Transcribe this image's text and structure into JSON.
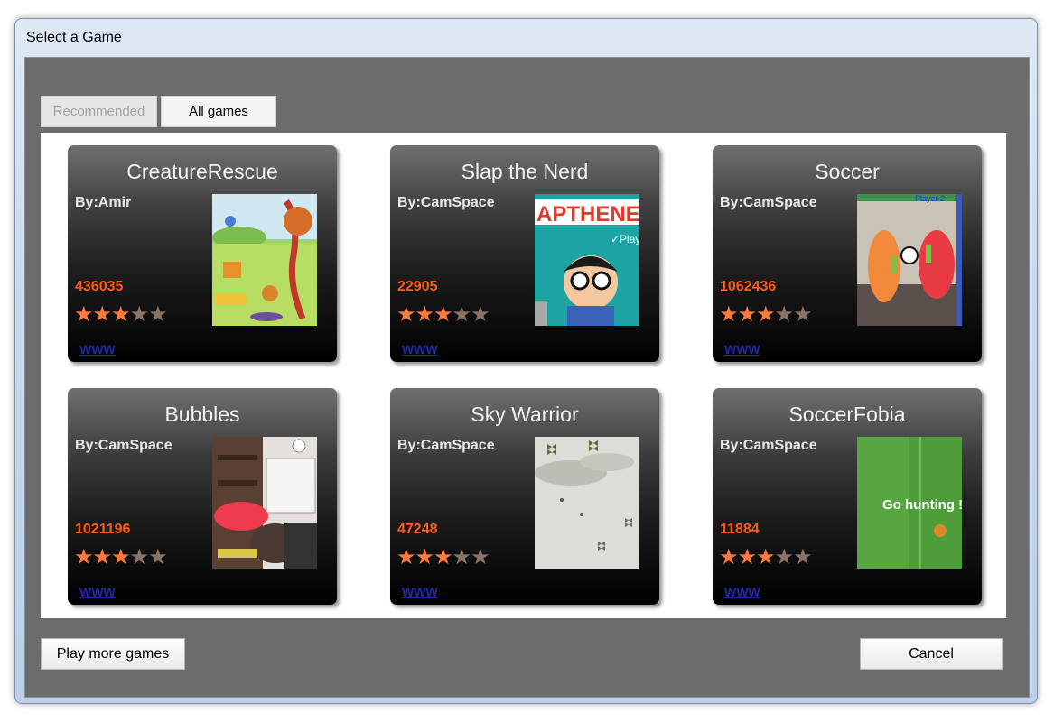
{
  "window": {
    "title": "Select a Game"
  },
  "tabs": {
    "recommended": "Recommended",
    "all_games": "All games"
  },
  "games": [
    {
      "title": "CreatureRescue",
      "author": "By:Amir",
      "count": "436035",
      "rating": 3,
      "rating_max": 5,
      "link": "WWW",
      "thumb": "creature-rescue-screenshot"
    },
    {
      "title": "Slap the Nerd",
      "author": "By:CamSpace",
      "count": "22905",
      "rating": 3,
      "rating_max": 5,
      "link": "WWW",
      "thumb": "slap-the-nerd-screenshot",
      "thumb_text": "APTHENEF",
      "thumb_play": "✓Play"
    },
    {
      "title": "Soccer",
      "author": "By:CamSpace",
      "count": "1062436",
      "rating": 3,
      "rating_max": 5,
      "link": "WWW",
      "thumb": "soccer-screenshot",
      "thumb_text": "Player 2"
    },
    {
      "title": "Bubbles",
      "author": "By:CamSpace",
      "count": "1021196",
      "rating": 3,
      "rating_max": 5,
      "link": "WWW",
      "thumb": "bubbles-screenshot"
    },
    {
      "title": "Sky Warrior",
      "author": "By:CamSpace",
      "count": "47248",
      "rating": 3,
      "rating_max": 5,
      "link": "WWW",
      "thumb": "sky-warrior-screenshot"
    },
    {
      "title": "SoccerFobia",
      "author": "By:CamSpace",
      "count": "11884",
      "rating": 3,
      "rating_max": 5,
      "link": "WWW",
      "thumb": "soccerfobia-screenshot",
      "thumb_text": "Go hunting !"
    }
  ],
  "buttons": {
    "play_more": "Play more games",
    "cancel": "Cancel"
  },
  "colors": {
    "count": "#ff5a1a",
    "star_on": "#ff7a3c",
    "star_off": "#8a7466",
    "link": "#2028a8",
    "panel": "#6c6b6d"
  }
}
